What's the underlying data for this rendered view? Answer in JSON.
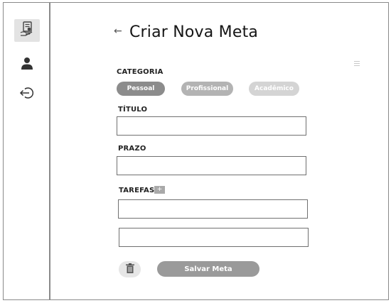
{
  "sidebar": {
    "items": [
      {
        "name": "goals",
        "icon": "goal-document-hand-icon",
        "active": true
      },
      {
        "name": "profile",
        "icon": "user-icon",
        "active": false
      },
      {
        "name": "logout",
        "icon": "logout-icon",
        "active": false
      }
    ]
  },
  "header": {
    "back_icon": "←",
    "title": "Criar Nova Meta"
  },
  "form": {
    "category_label": "CATEGORIA",
    "categories": [
      {
        "label": "Pessoal",
        "selected": true,
        "color": "#8c8c8c"
      },
      {
        "label": "Profissional",
        "selected": false,
        "color": "#b3b3b3"
      },
      {
        "label": "Acadêmico",
        "selected": false,
        "color": "#d4d4d4"
      }
    ],
    "title_label": "TÍTULO",
    "title_value": "",
    "deadline_label": "PRAZO",
    "deadline_value": "",
    "tasks_label": "TAREFAS",
    "add_task_symbol": "+",
    "tasks": [
      "",
      ""
    ],
    "save_label": "Salvar Meta"
  }
}
